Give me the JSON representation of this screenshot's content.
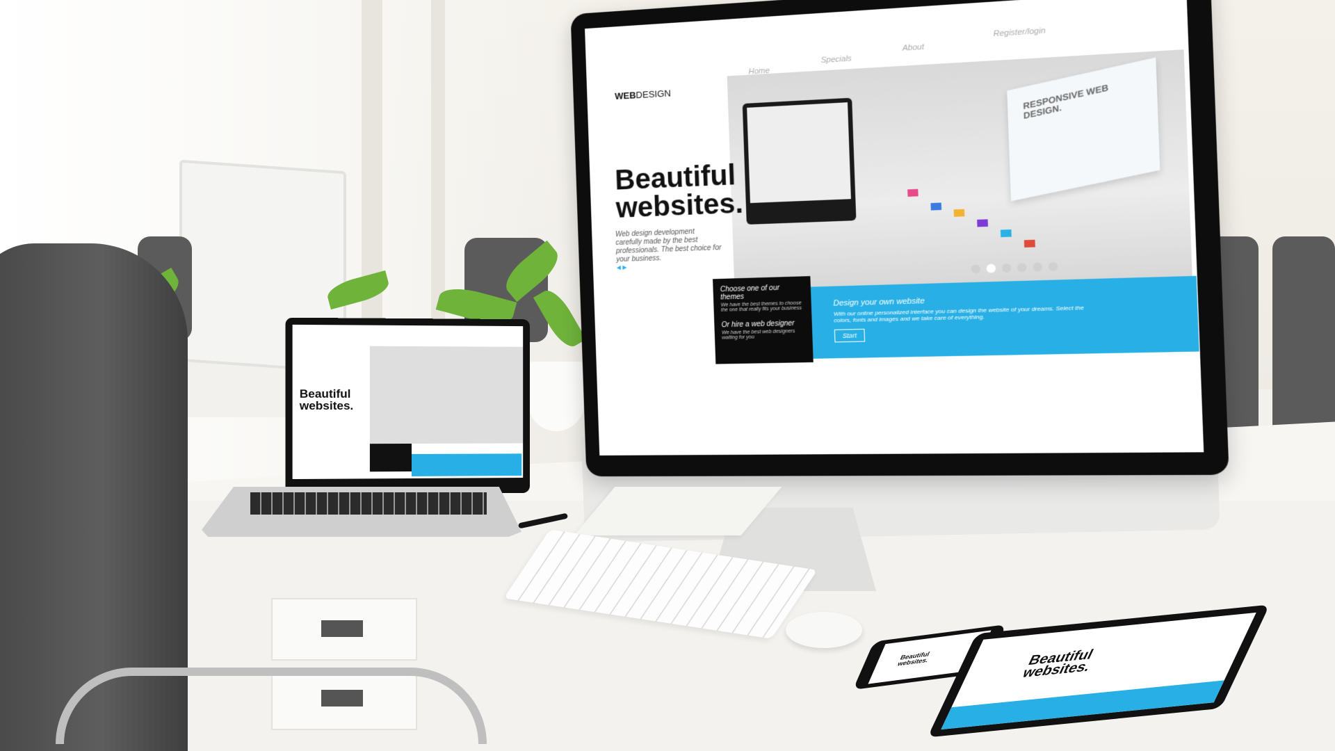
{
  "imac_site": {
    "logo_bold": "WEB",
    "logo_thin": "DESIGN",
    "nav": [
      "Home",
      "Specials",
      "About",
      "Register/login"
    ],
    "hero_title_line1": "Beautiful",
    "hero_title_line2": "websites.",
    "hero_subtitle": "Web design development carefully made by the best professionals. The best choice for your business.",
    "responsive_card": "RESPONSIVE WEB DESIGN.",
    "theme_heading": "Choose one of our themes",
    "theme_text": "We have the best themes to choose the one that really fits your business",
    "designer_heading": "Or hire a web designer",
    "designer_text": "We have the best web designers waiting for you",
    "design_heading": "Design your own website",
    "design_text": "With our online personalized interface you can design the website of your dreams. Select the colors, fonts and images and we take care of everything.",
    "start_button": "Start",
    "slider_dots": 6,
    "active_dot": 2
  },
  "laptop_site": {
    "title_line1": "Beautiful",
    "title_line2": "websites."
  },
  "tablet_site": {
    "title_line1": "Beautiful",
    "title_line2": "websites."
  },
  "phone_site": {
    "title_line1": "Beautiful",
    "title_line2": "websites."
  },
  "colors": {
    "accent_blue": "#28b0e6",
    "screen_black": "#0d0d0d",
    "plant_green": "#6fb33a"
  }
}
